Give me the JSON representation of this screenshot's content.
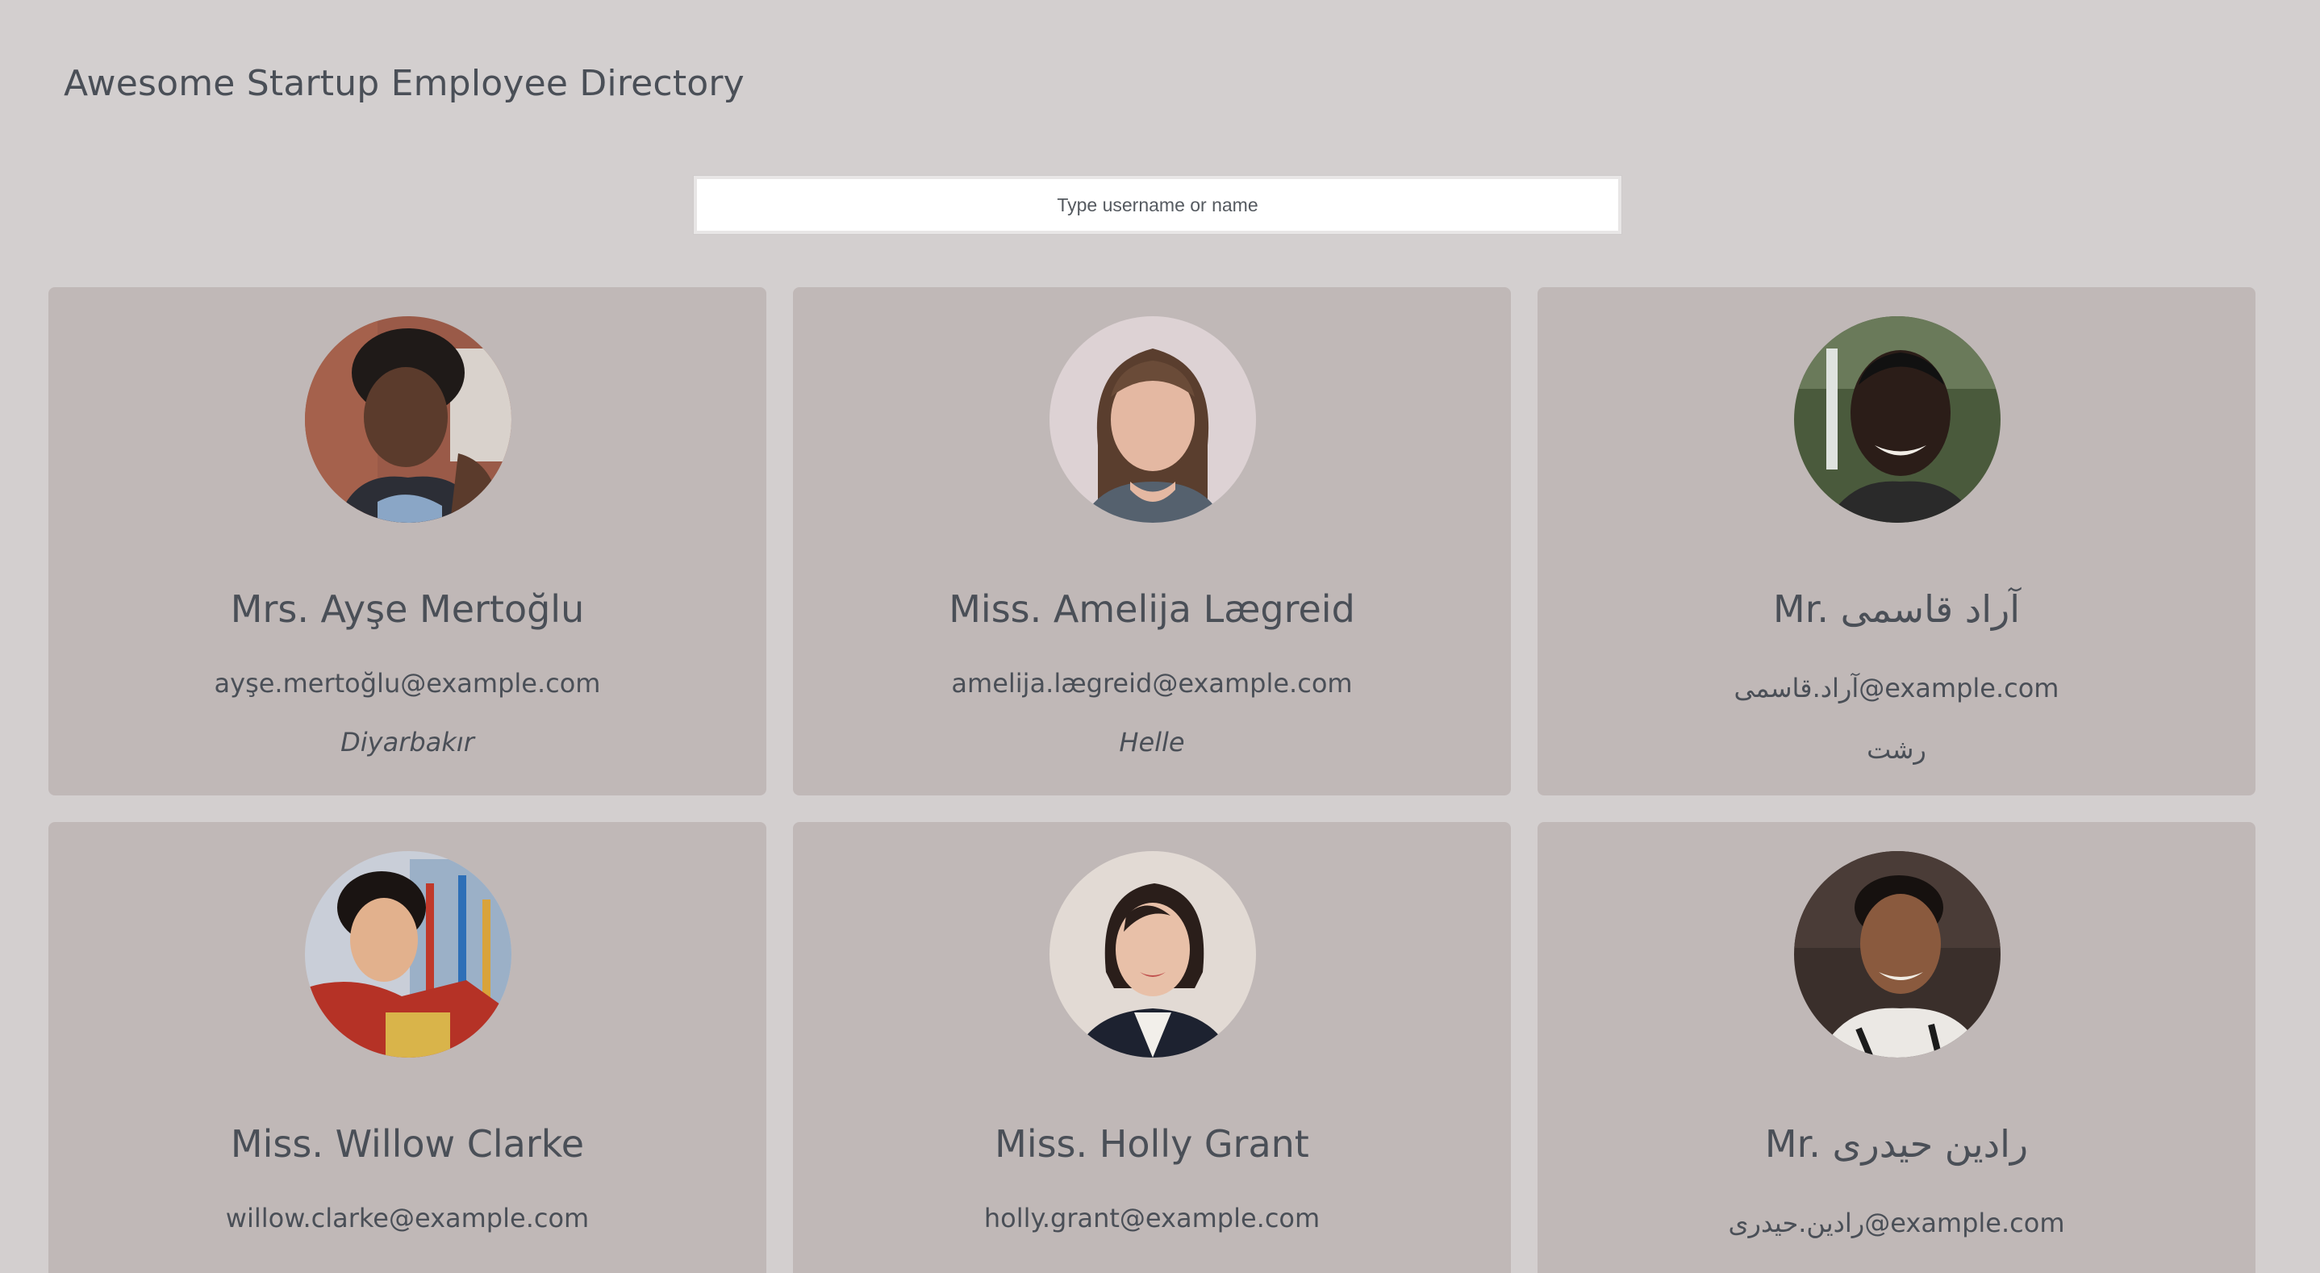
{
  "header": {
    "title": "Awesome Startup Employee Directory"
  },
  "search": {
    "placeholder": "Type username or name",
    "value": ""
  },
  "employees": [
    {
      "name": "Mrs. Ayşe Mertoğlu",
      "email": "ayşe.mertoğlu@example.com",
      "city": "Diyarbakır"
    },
    {
      "name": "Miss. Amelija Lægreid",
      "email": "amelija.lægreid@example.com",
      "city": "Helle"
    },
    {
      "name": "Mr. آراد قاسمی",
      "email": "آراد.قاسمی@example.com",
      "city": "رشت"
    },
    {
      "name": "Miss. Willow Clarke",
      "email": "willow.clarke@example.com",
      "city": ""
    },
    {
      "name": "Miss. Holly Grant",
      "email": "holly.grant@example.com",
      "city": ""
    },
    {
      "name": "Mr. رادین حیدری",
      "email": "رادین.حیدری@example.com",
      "city": ""
    }
  ]
}
